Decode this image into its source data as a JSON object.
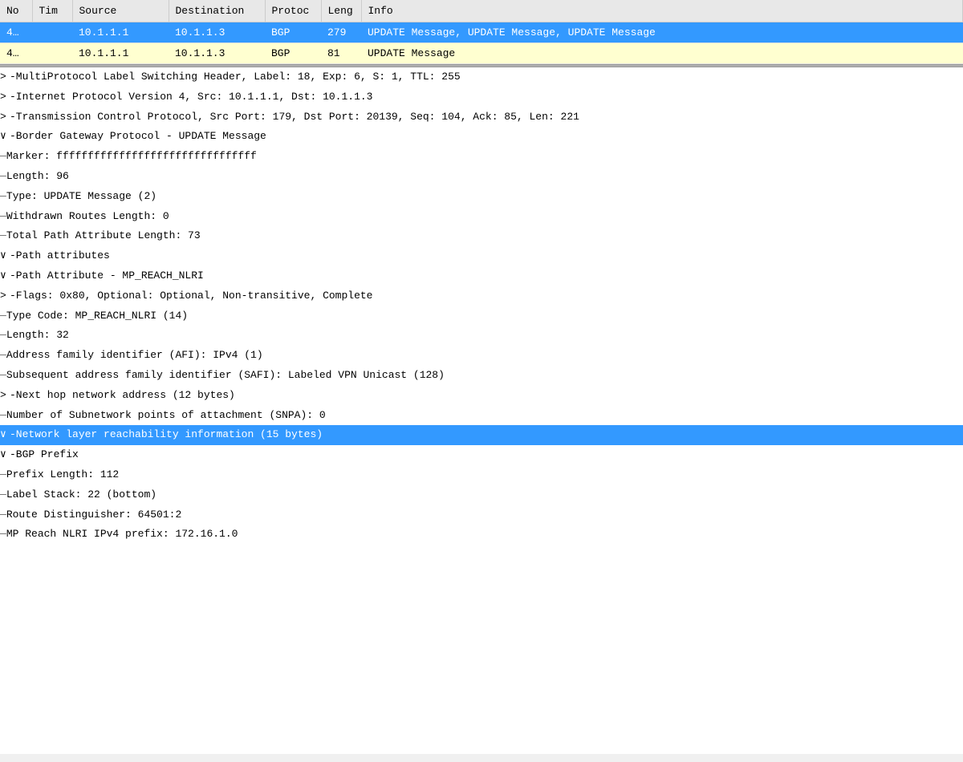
{
  "table": {
    "columns": [
      "No",
      "Tim",
      "Source",
      "Destination",
      "Protoc",
      "Leng",
      "Info"
    ],
    "rows": [
      {
        "no": "4…",
        "time": "",
        "source": "10.1.1.1",
        "destination": "10.1.1.3",
        "protocol": "BGP",
        "length": "279",
        "info": "UPDATE Message, UPDATE Message, UPDATE Message",
        "style": "selected"
      },
      {
        "no": "4…",
        "time": "",
        "source": "10.1.1.1",
        "destination": "10.1.1.3",
        "protocol": "BGP",
        "length": "81",
        "info": "UPDATE Message",
        "style": "highlighted"
      }
    ]
  },
  "detail": {
    "lines": [
      {
        "indent": 0,
        "expand": ">",
        "connector": "",
        "text": "MultiProtocol Label Switching Header, Label: 18, Exp: 6, S: 1, TTL: 255",
        "highlighted": false
      },
      {
        "indent": 0,
        "expand": ">",
        "connector": "",
        "text": "Internet Protocol Version 4, Src: 10.1.1.1, Dst: 10.1.1.3",
        "highlighted": false
      },
      {
        "indent": 0,
        "expand": ">",
        "connector": "",
        "text": "Transmission Control Protocol, Src Port: 179, Dst Port: 20139, Seq: 104, Ack: 85, Len: 221",
        "highlighted": false
      },
      {
        "indent": 0,
        "expand": "v",
        "connector": "",
        "text": "Border Gateway Protocol - UPDATE Message",
        "highlighted": false
      },
      {
        "indent": 1,
        "expand": "",
        "connector": "—",
        "text": "Marker: ffffffffffffffffffffffffffffffff",
        "highlighted": false
      },
      {
        "indent": 1,
        "expand": "",
        "connector": "—",
        "text": "Length: 96",
        "highlighted": false
      },
      {
        "indent": 1,
        "expand": "",
        "connector": "—",
        "text": "Type: UPDATE Message (2)",
        "highlighted": false
      },
      {
        "indent": 1,
        "expand": "",
        "connector": "—",
        "text": "Withdrawn Routes Length: 0",
        "highlighted": false
      },
      {
        "indent": 1,
        "expand": "",
        "connector": "—",
        "text": "Total Path Attribute Length: 73",
        "highlighted": false
      },
      {
        "indent": 1,
        "expand": "v",
        "connector": "",
        "text": "Path attributes",
        "highlighted": false
      },
      {
        "indent": 2,
        "expand": "v",
        "connector": "",
        "text": "Path Attribute - MP_REACH_NLRI",
        "highlighted": false
      },
      {
        "indent": 3,
        "expand": ">",
        "connector": "",
        "text": "Flags: 0x80, Optional: Optional, Non-transitive, Complete",
        "highlighted": false
      },
      {
        "indent": 3,
        "expand": "",
        "connector": "—",
        "text": "Type Code: MP_REACH_NLRI (14)",
        "highlighted": false
      },
      {
        "indent": 3,
        "expand": "",
        "connector": "—",
        "text": "Length: 32",
        "highlighted": false
      },
      {
        "indent": 3,
        "expand": "",
        "connector": "—",
        "text": "Address family identifier (AFI): IPv4 (1)",
        "highlighted": false
      },
      {
        "indent": 3,
        "expand": "",
        "connector": "—",
        "text": "Subsequent address family identifier (SAFI): Labeled VPN Unicast (128)",
        "highlighted": false
      },
      {
        "indent": 3,
        "expand": ">",
        "connector": "",
        "text": "Next hop network address (12 bytes)",
        "highlighted": false
      },
      {
        "indent": 3,
        "expand": "",
        "connector": "—",
        "text": "Number of Subnetwork points of attachment (SNPA): 0",
        "highlighted": false
      },
      {
        "indent": 3,
        "expand": "v",
        "connector": "",
        "text": "Network layer reachability information (15 bytes)",
        "highlighted": true
      },
      {
        "indent": 4,
        "expand": "v",
        "connector": "",
        "text": "BGP Prefix",
        "highlighted": false
      },
      {
        "indent": 5,
        "expand": "",
        "connector": "—",
        "text": "Prefix Length: 112",
        "highlighted": false
      },
      {
        "indent": 5,
        "expand": "",
        "connector": "—",
        "text": "Label Stack: 22 (bottom)",
        "highlighted": false
      },
      {
        "indent": 5,
        "expand": "",
        "connector": "—",
        "text": "Route Distinguisher: 64501:2",
        "highlighted": false
      },
      {
        "indent": 5,
        "expand": "",
        "connector": "—",
        "text": "MP Reach NLRI IPv4 prefix: 172.16.1.0",
        "highlighted": false
      }
    ]
  },
  "colors": {
    "selected_row_bg": "#3399ff",
    "highlighted_row_bg": "#ffffd0",
    "tree_highlight_bg": "#3399ff",
    "tree_highlight_text": "#ffffff",
    "header_bg": "#e8e8e8"
  }
}
